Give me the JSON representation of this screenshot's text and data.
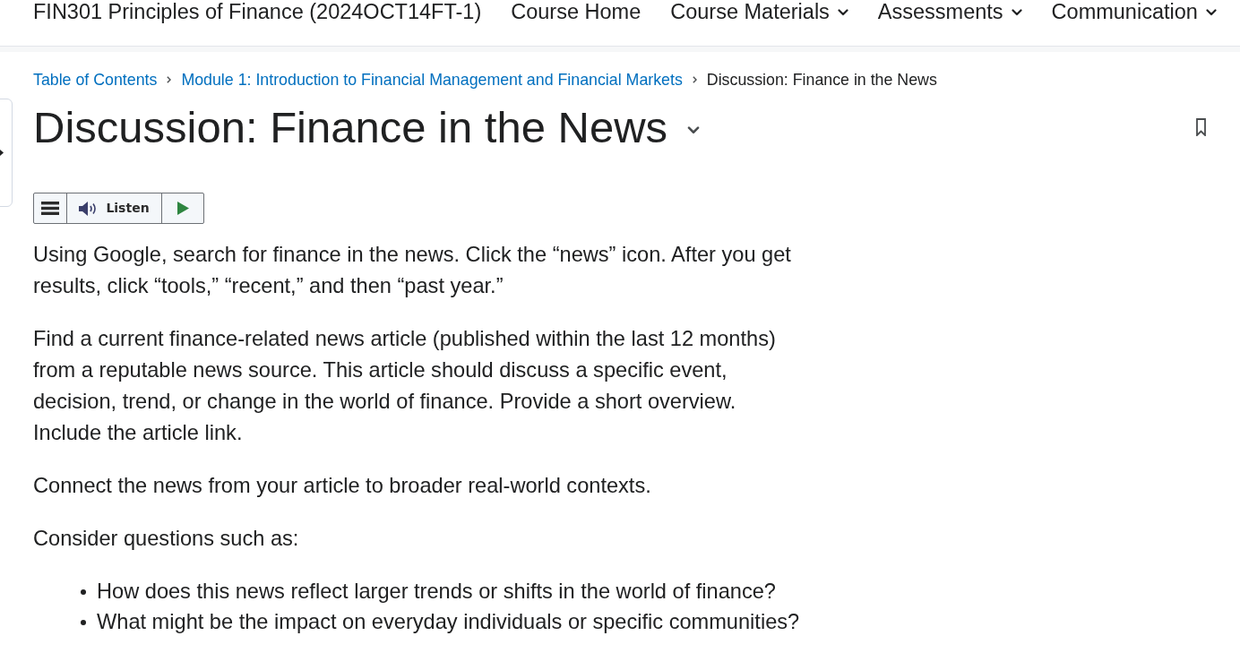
{
  "course_bar": {
    "title": "FIN301 Principles of Finance (2024OCT14FT-1)",
    "nav": [
      {
        "label": "Course Home",
        "has_menu": false
      },
      {
        "label": "Course Materials",
        "has_menu": true
      },
      {
        "label": "Assessments",
        "has_menu": true
      },
      {
        "label": "Communication",
        "has_menu": true
      }
    ]
  },
  "breadcrumb": [
    {
      "label": "Table of Contents",
      "kind": "link"
    },
    {
      "label": "Module 1: Introduction to Financial Management and Financial Markets",
      "kind": "link"
    },
    {
      "label": "Discussion: Finance in the News",
      "kind": "current"
    }
  ],
  "heading": "Discussion: Finance in the News",
  "listen_toolbar": {
    "label": "Listen"
  },
  "body": [
    {
      "kind": "paragraph",
      "text": "Using Google, search for finance in the news. Click the “news” icon. After you get results, click “tools,” “recent,” and then “past year.”"
    },
    {
      "kind": "paragraph",
      "text": "Find a current finance-related news article (published within the last 12 months) from a reputable news source. This article should discuss a specific event, decision, trend, or change in the world of finance. Provide a short overview. Include the article link."
    },
    {
      "kind": "paragraph",
      "text": "Connect the news from your article to broader real-world contexts."
    },
    {
      "kind": "paragraph",
      "text": "Consider questions such as:"
    },
    {
      "kind": "list",
      "items": [
        "How does this news reflect larger trends or shifts in the world of finance?",
        "What might be the impact on everyday individuals or specific communities?"
      ]
    }
  ]
}
